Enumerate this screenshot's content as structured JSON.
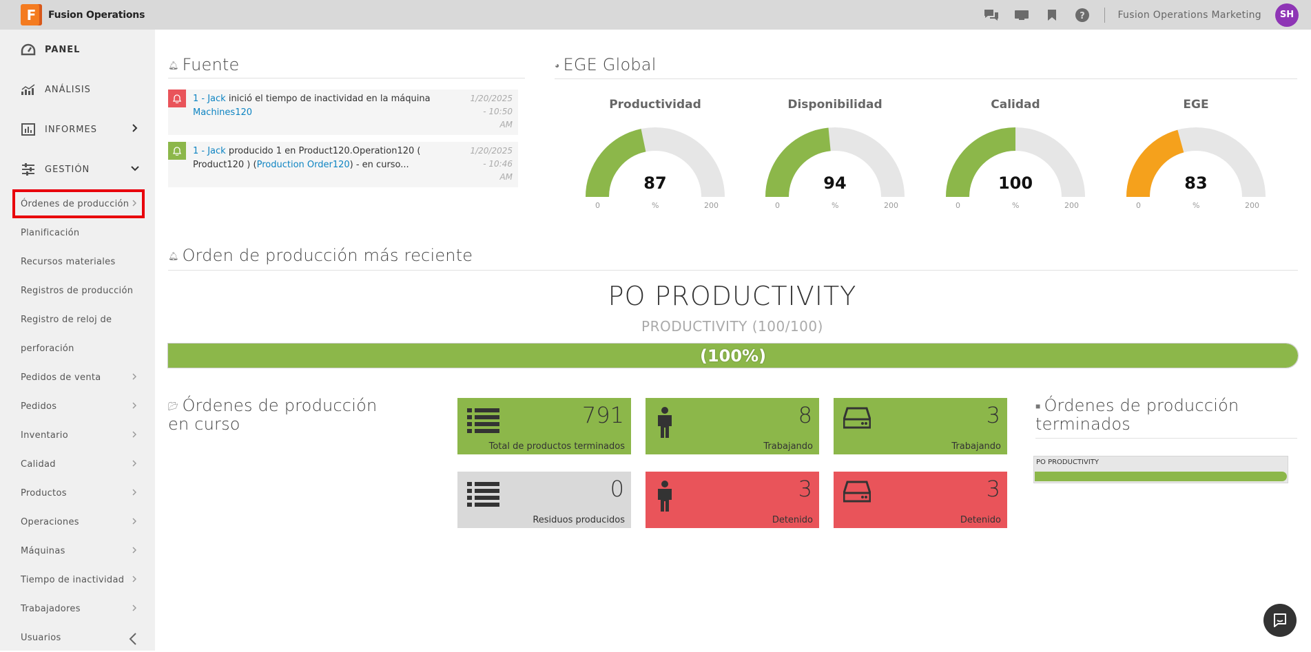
{
  "app": {
    "title": "Fusion Operations",
    "logo_letter": "F",
    "org_name": "Fusion Operations Marketing",
    "user_initials": "SH"
  },
  "topbar_icons": [
    "chat-icon",
    "tv-icon",
    "bookmark-icon",
    "help-icon"
  ],
  "sidebar": {
    "main_items": [
      {
        "label": "PANEL",
        "icon": "dashboard-icon"
      },
      {
        "label": "ANÁLISIS",
        "icon": "chart-icon"
      },
      {
        "label": "INFORMES",
        "icon": "bar-chart-icon"
      },
      {
        "label": "GESTIÓN",
        "icon": "sliders-icon"
      }
    ],
    "sub_items": [
      {
        "label": "Órdenes de producción"
      },
      {
        "label": "Planificación"
      },
      {
        "label": "Recursos materiales"
      },
      {
        "label": "Registros de producción"
      },
      {
        "label": "Registro de reloj de"
      },
      {
        "label": "perforación"
      },
      {
        "label": "Pedidos de venta"
      },
      {
        "label": "Pedidos"
      },
      {
        "label": "Inventario"
      },
      {
        "label": "Calidad"
      },
      {
        "label": "Productos"
      },
      {
        "label": "Operaciones"
      },
      {
        "label": "Máquinas"
      },
      {
        "label": "Tiempo de inactividad"
      },
      {
        "label": "Trabajadores"
      },
      {
        "label": "Usuarios"
      }
    ]
  },
  "feed": {
    "title": "Fuente",
    "items": [
      {
        "type": "alert",
        "color": "#e9545a",
        "actor": "1 - Jack",
        "text": " inició el tiempo de inactividad en la máquina ",
        "link": "Machines120",
        "tail": "",
        "date_line1": "1/20/2025",
        "date_line2": "- 10:50",
        "date_line3": "AM"
      },
      {
        "type": "produced",
        "color": "#8cb74a",
        "actor": "1 - Jack",
        "text": " producido 1 en Product120.Operation120 ( Product120 ) (",
        "link": "Production Order120",
        "tail": ") - en curso...",
        "date_line1": "1/20/2025",
        "date_line2": "- 10:46",
        "date_line3": "AM"
      }
    ]
  },
  "oee": {
    "title": "EGE Global",
    "gauges": [
      {
        "label": "Productividad",
        "value": 87,
        "min": "0",
        "max": "200",
        "unit": "%",
        "value_text": "87",
        "color": "#8cb74a"
      },
      {
        "label": "Disponibilidad",
        "value": 94,
        "min": "0",
        "max": "200",
        "unit": "%",
        "value_text": "94",
        "color": "#8cb74a"
      },
      {
        "label": "Calidad",
        "value": 100,
        "min": "0",
        "max": "200",
        "unit": "%",
        "value_text": "100",
        "color": "#8cb74a"
      },
      {
        "label": "EGE",
        "value": 83,
        "min": "0",
        "max": "200",
        "unit": "%",
        "value_text": "83",
        "color": "#f5a11c"
      }
    ]
  },
  "recent_order": {
    "title": "Orden de producción más reciente",
    "name": "PO PRODUCTIVITY",
    "subtitle": "PRODUCTIVITY (100/100)",
    "progress": 1.0,
    "progress_text": "(100%)"
  },
  "in_progress": {
    "title": "Órdenes de producción en curso",
    "tiles": [
      {
        "value": "791",
        "label": "Total de productos terminados",
        "icon": "list-icon",
        "color": "green"
      },
      {
        "value": "8",
        "label": "Trabajando",
        "icon": "person-icon",
        "color": "green"
      },
      {
        "value": "3",
        "label": "Trabajando",
        "icon": "machine-icon",
        "color": "green"
      },
      {
        "value": "0",
        "label": "Residuos producidos",
        "icon": "list-icon",
        "color": "grey"
      },
      {
        "value": "3",
        "label": "Detenido",
        "icon": "person-icon",
        "color": "red"
      },
      {
        "value": "3",
        "label": "Detenido",
        "icon": "machine-icon",
        "color": "red"
      }
    ]
  },
  "finished": {
    "title": "Órdenes de producción terminados",
    "items": [
      {
        "label": "PO PRODUCTIVITY",
        "progress": 1.0
      }
    ]
  }
}
